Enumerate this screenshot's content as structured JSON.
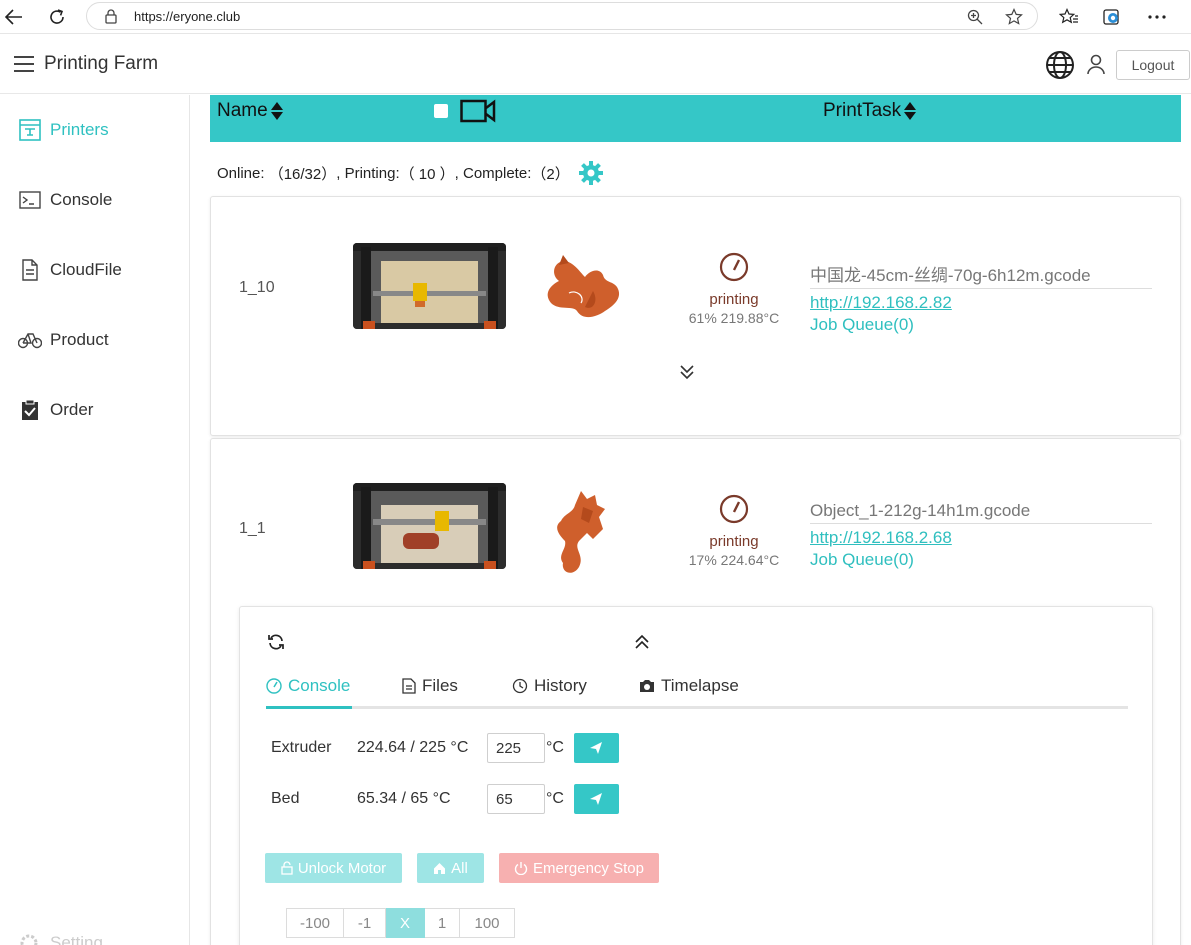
{
  "browser": {
    "url": "https://eryone.club"
  },
  "header": {
    "title": "Printing Farm",
    "logout_label": "Logout"
  },
  "sidebar": {
    "items": [
      {
        "label": "Printers",
        "icon": "printer-icon",
        "active": true
      },
      {
        "label": "Console",
        "icon": "terminal-icon"
      },
      {
        "label": "CloudFile",
        "icon": "file-icon"
      },
      {
        "label": "Product",
        "icon": "bicycle-icon"
      },
      {
        "label": "Order",
        "icon": "clipboard-check-icon"
      }
    ],
    "setting_label": "Setting"
  },
  "table": {
    "col_name": "Name",
    "col_task": "PrintTask"
  },
  "stats": {
    "online_label": "Online:",
    "online_value": "（16/32）",
    "printing_label": ", Printing:",
    "printing_value": "（ 10 ）",
    "complete_label": ", Complete:",
    "complete_value": "（2）"
  },
  "printers": [
    {
      "name": "1_10",
      "status": "printing",
      "progress_temp": "61% 219.88°C",
      "file": "中国龙-45cm-丝绸-70g-6h12m.gcode",
      "link": "http://192.168.2.82",
      "queue": "Job Queue(0)"
    },
    {
      "name": "1_1",
      "status": "printing",
      "progress_temp": "17% 224.64°C",
      "file": "Object_1-212g-14h1m.gcode",
      "link": "http://192.168.2.68",
      "queue": "Job Queue(0)"
    }
  ],
  "console": {
    "tabs": [
      "Console",
      "Files",
      "History",
      "Timelapse"
    ],
    "extruder": {
      "label": "Extruder",
      "reading": "224.64 / 225 °C",
      "input": "225",
      "unit": "°C"
    },
    "bed": {
      "label": "Bed",
      "reading": "65.34 / 65 °C",
      "input": "65",
      "unit": "°C"
    },
    "buttons": {
      "unlock": "Unlock Motor",
      "home_all": "All",
      "emergency": "Emergency Stop"
    },
    "jog": [
      "-100",
      "-1",
      "X",
      "1",
      "100"
    ]
  },
  "colors": {
    "accent": "#35c7c7",
    "danger": "#f7b0b0"
  }
}
